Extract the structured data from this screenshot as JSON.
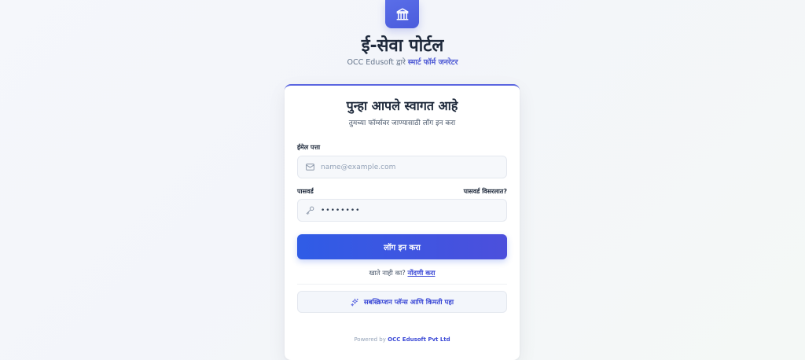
{
  "header": {
    "title": "ई-सेवा पोर्टल",
    "subtitle_prefix": "OCC Edusoft द्वारे",
    "subtitle_accent": "स्मार्ट फॉर्म जनरेटर",
    "logo_icon": "bank-building-icon"
  },
  "login": {
    "welcome": "पुन्हा आपले स्वागत आहे",
    "welcome_sub": "तुमच्या फॉर्म्सवर जाण्यासाठी लॉग इन करा",
    "email_label": "ईमेल पत्ता",
    "email_placeholder": "name@example.com",
    "email_value": "",
    "password_label": "पासवर्ड",
    "forgot_label": "पासवर्ड विसरलात?",
    "password_value": "........",
    "submit_label": "लॉग इन करा",
    "register_prompt": "खाते नाही का?",
    "register_link": "नोंदणी करा",
    "subscription_label": "सबस्क्रिप्शन प्लॅन्स आणि किमती पहा"
  },
  "footer": {
    "powered_prefix": "Powered by",
    "powered_company": "OCC Edusoft Pvt Ltd"
  },
  "colors": {
    "accent": "#4f5bd5",
    "button_start": "#2f5ce6",
    "button_end": "#4c4fdc"
  }
}
